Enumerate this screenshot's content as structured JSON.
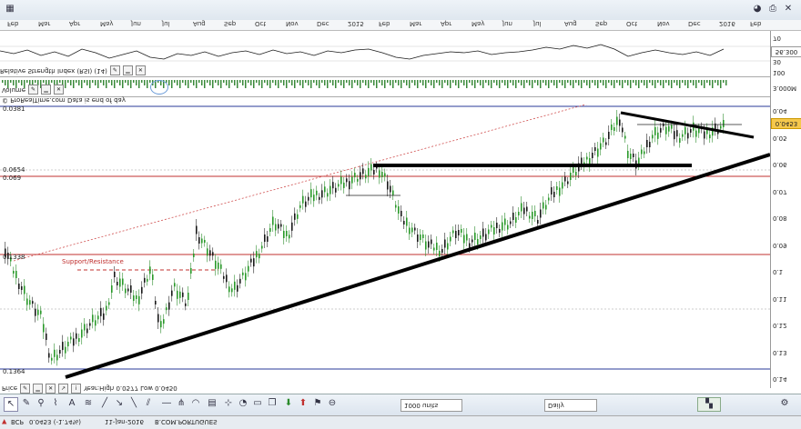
{
  "months_top": [
    "Feb",
    "Mar",
    "Apr",
    "May",
    "Jun",
    "Jul",
    "Aug",
    "Sep",
    "Oct",
    "Nov",
    "Dec",
    "2015",
    "Feb",
    "Mar",
    "Apr",
    "May",
    "Jun",
    "Jul",
    "Aug",
    "Sep",
    "Oct",
    "Nov",
    "Dec",
    "2016",
    "Feb"
  ],
  "rsi": {
    "header": "Relative Strength Index (RSI) (14)",
    "value": "56.300",
    "levels": [
      "70",
      "30",
      "100"
    ]
  },
  "volume": {
    "header": "Volume",
    "value": "3.000M",
    "label": "RSI"
  },
  "info_line": "© ProRealTime.com Data is end of day",
  "price_header": "Price",
  "price_info": "Year:High 0.0577 Low 0.0450",
  "price_axis": [
    "0.04",
    "0.05",
    "0.06",
    "0.07",
    "0.08",
    "0.09",
    "0.1",
    "0.11",
    "0.12",
    "0.13",
    "0.14"
  ],
  "left_labels": {
    "top": "0.0381",
    "mid1": "0.0654",
    "mid2": "0.069",
    "low": "0.1338",
    "bottom": "0.1364",
    "support": "Support/Resistance"
  },
  "current_price": "0.0453",
  "toolbar": {
    "zoom_select": "1000 units",
    "period_select": "Daily"
  },
  "status": {
    "ticker": "BCP",
    "price": "0.0453 (-1.74%)",
    "date": "11-Jan-2016",
    "name": "B.COM.PORTUGUES"
  },
  "colors": {
    "trend": "#000000",
    "level": "#c0302f",
    "bull": "#2a8a2a",
    "bear": "#202020",
    "accent": "#f5c84c"
  }
}
